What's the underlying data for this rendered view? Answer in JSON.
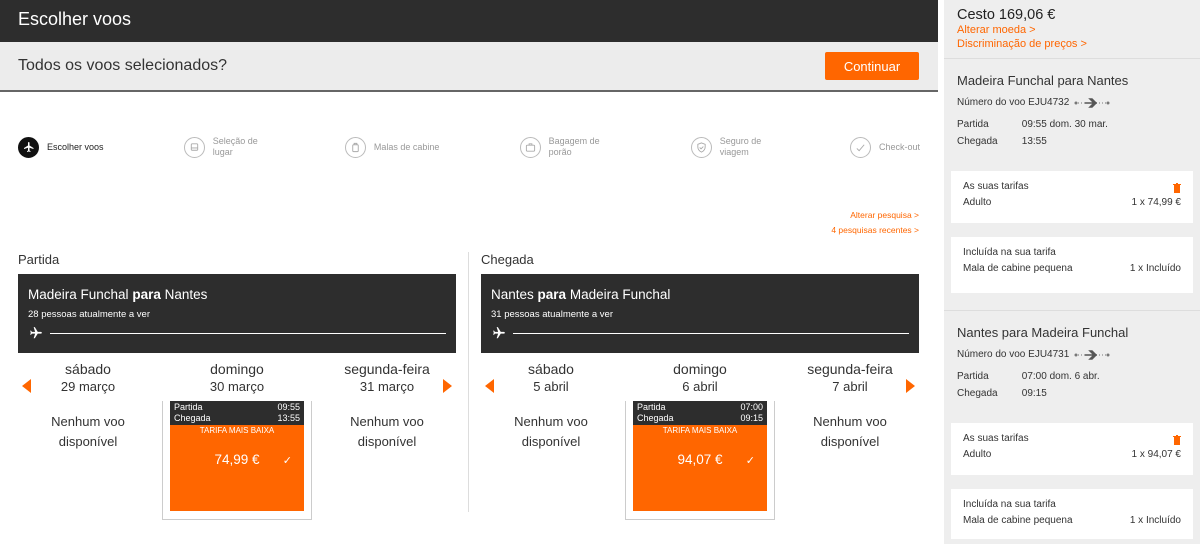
{
  "header": {
    "title": "Escolher voos"
  },
  "selection": {
    "question": "Todos os voos selecionados?",
    "continue_label": "Continuar"
  },
  "steps": [
    {
      "label": "Escolher voos",
      "icon": "plane-icon",
      "active": true
    },
    {
      "label": "Seleção de lugar",
      "icon": "seat-icon",
      "active": false
    },
    {
      "label": "Malas de cabine",
      "icon": "cabin-bag-icon",
      "active": false
    },
    {
      "label": "Bagagem de porão",
      "icon": "hold-bag-icon",
      "active": false
    },
    {
      "label": "Seguro de viagem",
      "icon": "shield-icon",
      "active": false
    },
    {
      "label": "Check-out",
      "icon": "checkout-icon",
      "active": false
    }
  ],
  "links": {
    "alter_search": "Alterar pesquisa >",
    "recent_searches": "4 pesquisas recentes >"
  },
  "outbound": {
    "heading": "Partida",
    "route_from": "Madeira Funchal",
    "route_connector": "para",
    "route_to": "Nantes",
    "people": "28 pessoas atualmente a ver",
    "days": [
      {
        "name": "sábado",
        "date": "29 março",
        "none": "Nenhum voo disponível"
      },
      {
        "name": "domingo",
        "date": "30 março"
      },
      {
        "name": "segunda-feira",
        "date": "31 março",
        "none": "Nenhum voo disponível"
      }
    ],
    "card": {
      "dep_label": "Partida",
      "dep_time": "09:55",
      "arr_label": "Chegada",
      "arr_time": "13:55",
      "tag": "TARIFA MAIS BAIXA",
      "price": "74,99 €"
    }
  },
  "inbound": {
    "heading": "Chegada",
    "route_from": "Nantes",
    "route_connector": "para",
    "route_to": "Madeira Funchal",
    "people": "31 pessoas atualmente a ver",
    "days": [
      {
        "name": "sábado",
        "date": "5 abril",
        "none": "Nenhum voo disponível"
      },
      {
        "name": "domingo",
        "date": "6 abril"
      },
      {
        "name": "segunda-feira",
        "date": "7 abril",
        "none": "Nenhum voo disponível"
      }
    ],
    "card": {
      "dep_label": "Partida",
      "dep_time": "07:00",
      "arr_label": "Chegada",
      "arr_time": "09:15",
      "tag": "TARIFA MAIS BAIXA",
      "price": "94,07 €"
    }
  },
  "basket": {
    "total": "Cesto 169,06 €",
    "change_currency": "Alterar moeda >",
    "price_breakdown": "Discriminação de preços >",
    "segments": [
      {
        "title": "Madeira Funchal para Nantes",
        "flight_no": "Número do voo EJU4732",
        "dep_label": "Partida",
        "dep_value": "09:55 dom. 30 mar.",
        "arr_label": "Chegada",
        "arr_value": "13:55",
        "fares_title": "As suas tarifas",
        "pax": "Adulto",
        "pax_price": "1 x 74,99 €",
        "incl_title": "Incluída na sua tarifa",
        "incl_item": "Mala de cabine pequena",
        "incl_value": "1 x Incluído"
      },
      {
        "title": "Nantes para Madeira Funchal",
        "flight_no": "Número do voo EJU4731",
        "dep_label": "Partida",
        "dep_value": "07:00 dom. 6 abr.",
        "arr_label": "Chegada",
        "arr_value": "09:15",
        "fares_title": "As suas tarifas",
        "pax": "Adulto",
        "pax_price": "1 x 94,07 €",
        "incl_title": "Incluída na sua tarifa",
        "incl_item": "Mala de cabine pequena",
        "incl_value": "1 x Incluído"
      }
    ]
  },
  "colors": {
    "accent": "#ff6600",
    "dark": "#2d2d2d",
    "sidebar_bg": "#eeeeee"
  }
}
